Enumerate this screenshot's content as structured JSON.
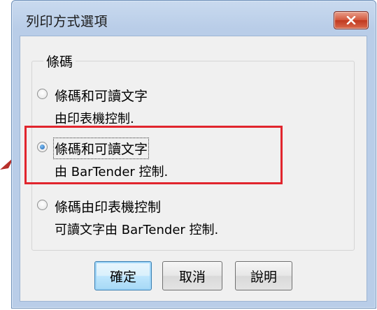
{
  "dialog": {
    "title": "列印方式選項",
    "close_icon": "close-icon"
  },
  "group": {
    "title": "條碼"
  },
  "options": [
    {
      "label": "條碼和可讀文字",
      "sub": "由印表機控制.",
      "checked": false
    },
    {
      "label": "條碼和可讀文字",
      "sub": "由 BarTender 控制.",
      "checked": true
    },
    {
      "label": "條碼由印表機控制",
      "sub": "可讀文字由 BarTender 控制.",
      "checked": false
    }
  ],
  "buttons": {
    "ok": "確定",
    "cancel": "取消",
    "help": "說明"
  },
  "colors": {
    "highlight": "#e1252d",
    "close_button": "#c0391f"
  }
}
